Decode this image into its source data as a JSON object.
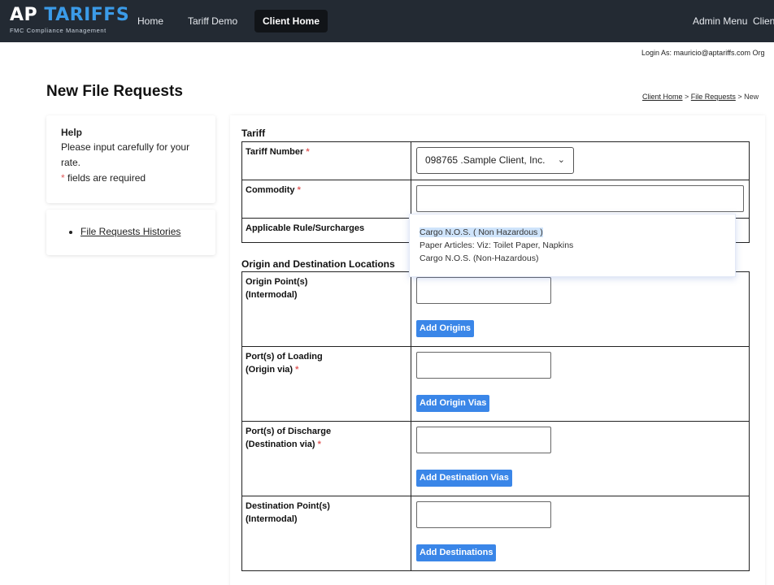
{
  "header": {
    "logo_main_part1": "AP ",
    "logo_main_part2": "TARIFFS",
    "logo_sub": "FMC Compliance Management",
    "nav": [
      {
        "label": "Home"
      },
      {
        "label": "Tariff Demo"
      },
      {
        "label": "Client Home"
      },
      {
        "label": "Admin Menu"
      },
      {
        "label": "Client"
      }
    ]
  },
  "login_as": "Login As: mauricio@aptariffs.com Org",
  "page_title": "New File Requests",
  "breadcrumb": {
    "item1": "Client Home",
    "sep": " > ",
    "item2": "File Requests",
    "current": "New"
  },
  "help": {
    "title": "Help",
    "line1": "Please input carefully for your rate.",
    "req_mark": "*",
    "req_text": " fields are required"
  },
  "links": {
    "histories": "File Requests Histories"
  },
  "tariff_section": {
    "title": "Tariff",
    "tariff_number_label": "Tariff Number",
    "tariff_number_value": "098765 .Sample Client, Inc.",
    "commodity_label": "Commodity",
    "commodity_value": "",
    "rule_label": "Applicable Rule/Surcharges",
    "required_mark": "*"
  },
  "suggestions": [
    "Cargo N.O.S. ( Non Hazardous )",
    "Paper Articles: Viz: Toilet Paper, Napkins",
    "Cargo N.O.S. (Non-Hazardous)"
  ],
  "locations_section": {
    "title": "Origin and Destination Locations",
    "rows": [
      {
        "label1": "Origin Point(s)",
        "label2": "(Intermodal)",
        "required": "",
        "button": "Add Origins"
      },
      {
        "label1": "Port(s) of Loading",
        "label2": "(Origin via)",
        "required": "*",
        "button": "Add Origin Vias"
      },
      {
        "label1": "Port(s) of Discharge",
        "label2": "(Destination via)",
        "required": "*",
        "button": "Add Destination Vias"
      },
      {
        "label1": "Destination Point(s)",
        "label2": "(Intermodal)",
        "required": "",
        "button": "Add Destinations"
      }
    ]
  },
  "colors": {
    "navbar": "#232a33",
    "accent": "#3b9be8",
    "button": "#3a86e8",
    "required": "#e05d5d"
  }
}
